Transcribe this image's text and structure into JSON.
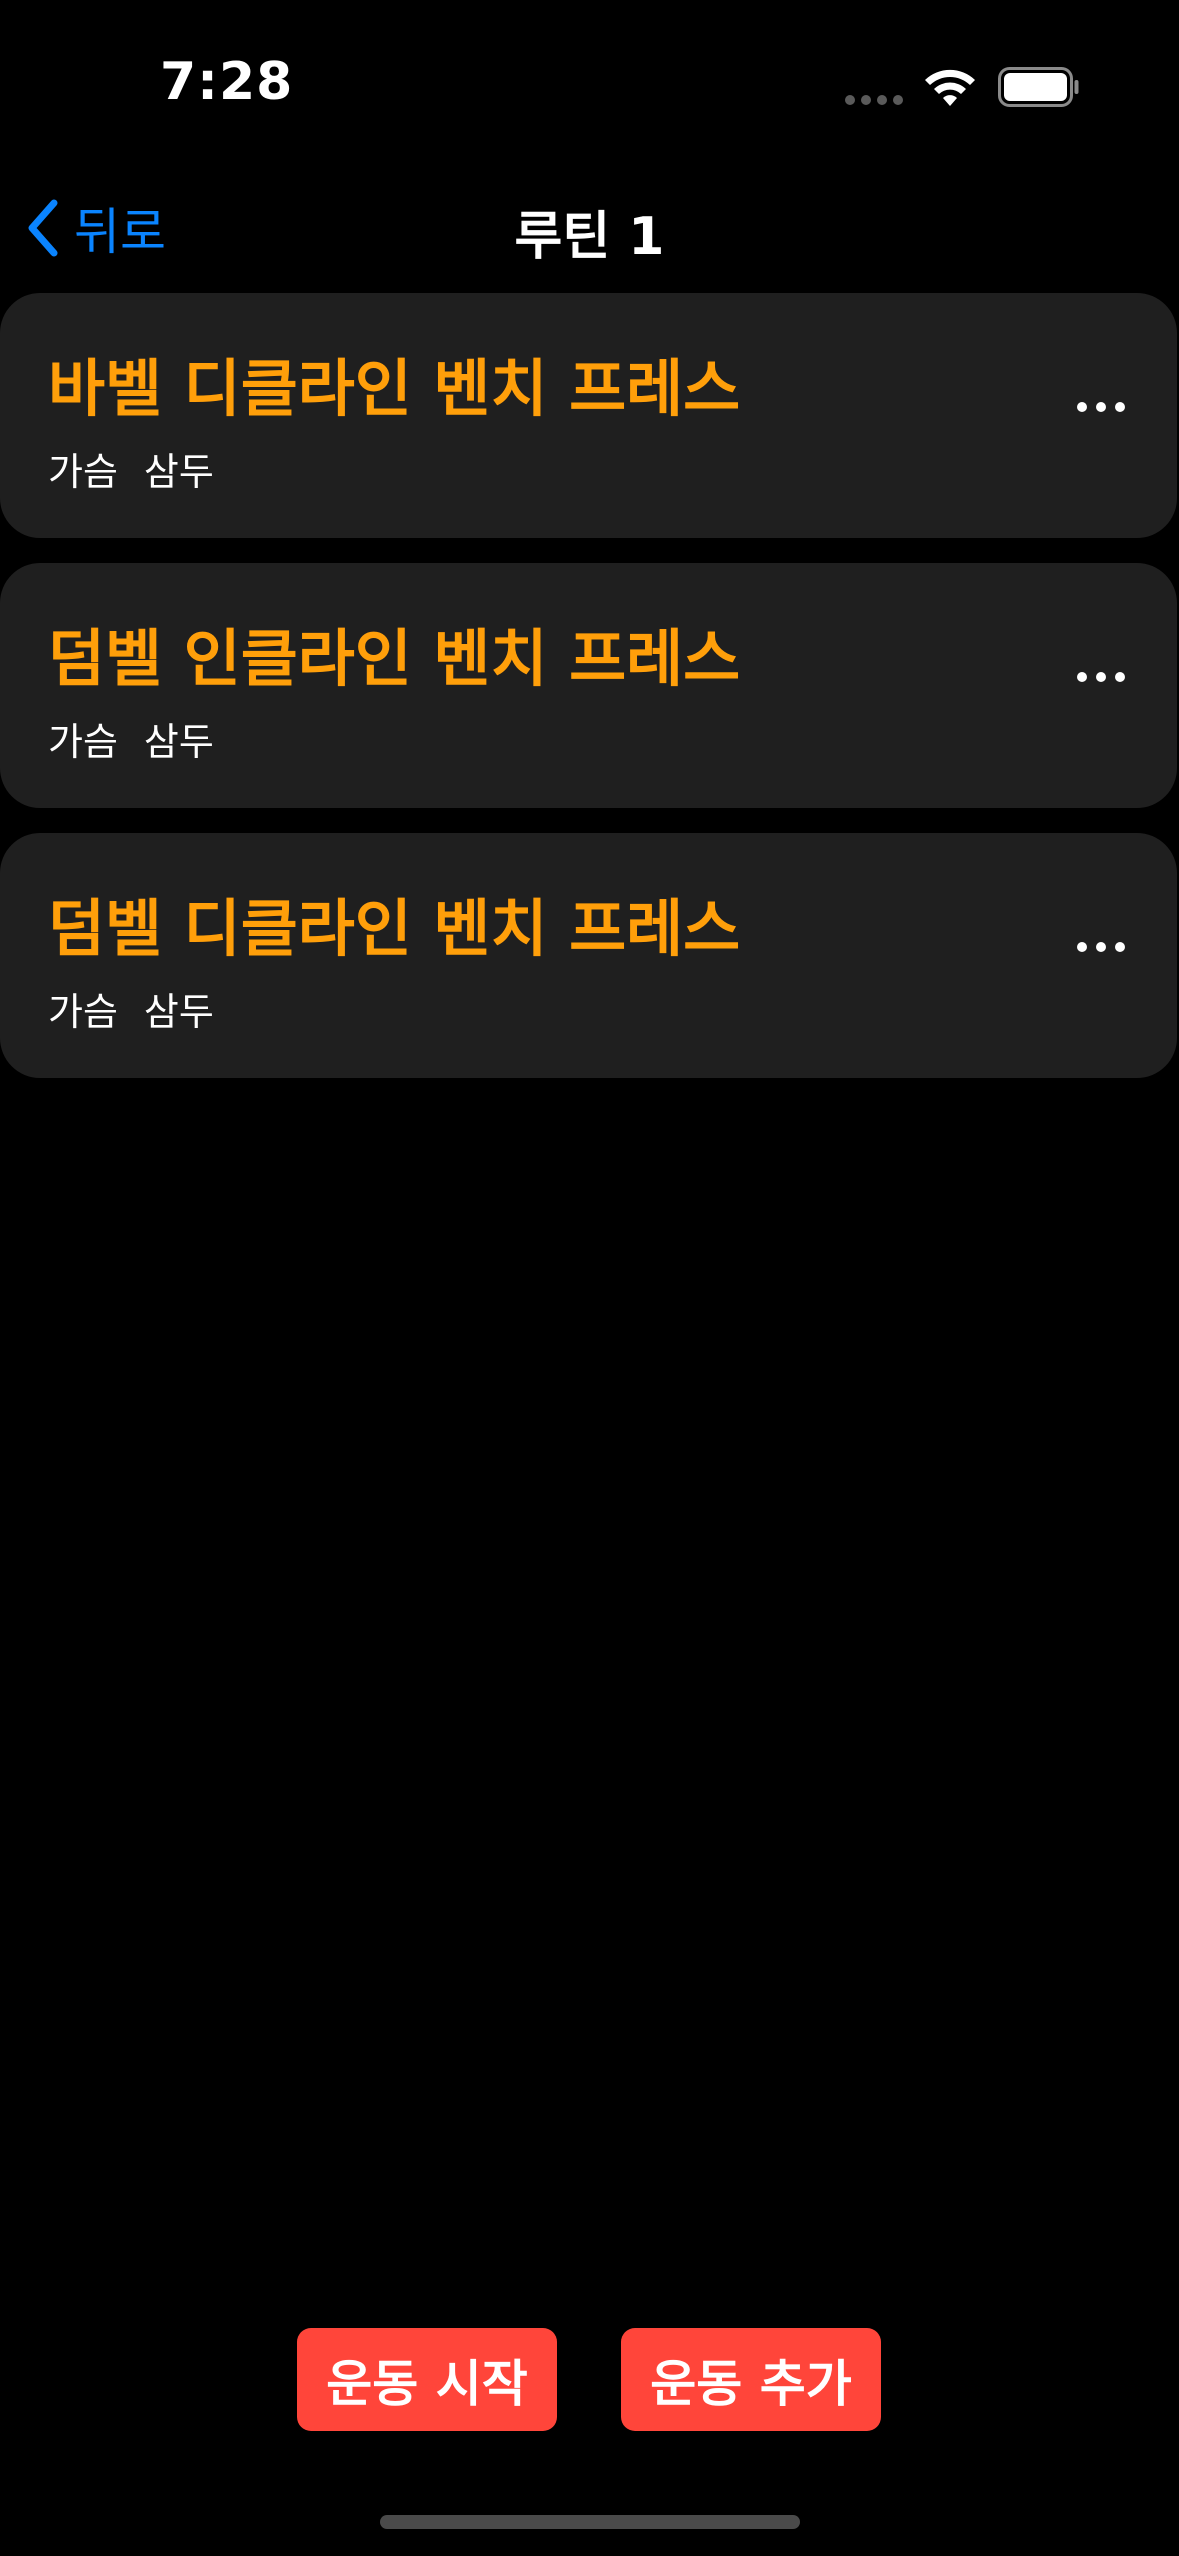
{
  "status_bar": {
    "time": "7:28",
    "signal_icon": "cellular-dots-icon",
    "wifi_icon": "wifi-icon",
    "battery_icon": "battery-icon"
  },
  "nav": {
    "back_icon": "chevron-left-icon",
    "back_label": "뒤로",
    "title": "루틴 1",
    "accent_color": "#0a84ff"
  },
  "exercises": [
    {
      "title": "바벨 디클라인 벤치 프레스",
      "tags": [
        "가슴",
        "삼두"
      ],
      "more_icon": "ellipsis-icon"
    },
    {
      "title": "덤벨 인클라인 벤치 프레스",
      "tags": [
        "가슴",
        "삼두"
      ],
      "more_icon": "ellipsis-icon"
    },
    {
      "title": "덤벨 디클라인 벤치 프레스",
      "tags": [
        "가슴",
        "삼두"
      ],
      "more_icon": "ellipsis-icon"
    }
  ],
  "colors": {
    "background": "#000000",
    "card": "#1f1f1f",
    "exercise_title": "#ff9f0a",
    "action_button": "#ff453a"
  },
  "actions": {
    "start_label": "운동 시작",
    "add_label": "운동 추가"
  }
}
